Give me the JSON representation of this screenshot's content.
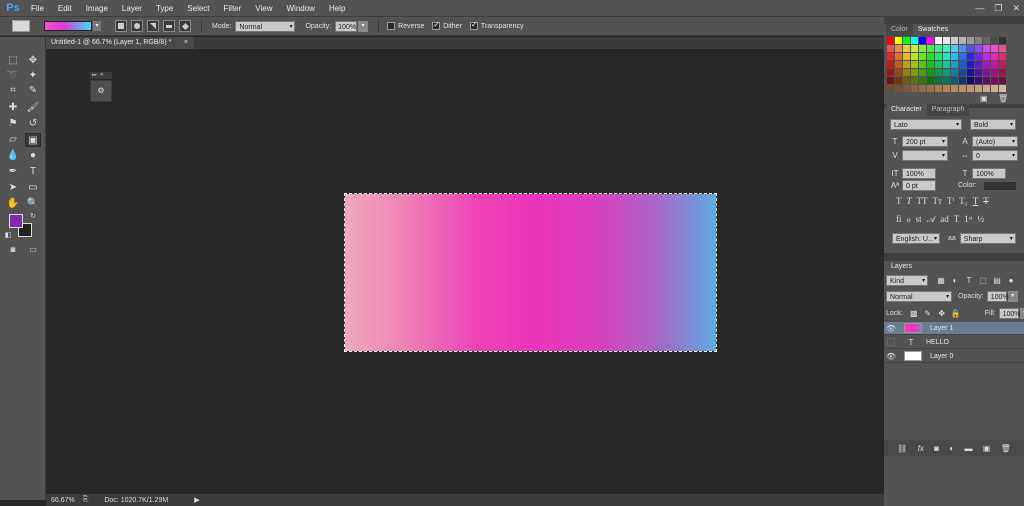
{
  "app": {
    "logo": "Ps"
  },
  "menu": [
    "File",
    "Edit",
    "Image",
    "Layer",
    "Type",
    "Select",
    "Filter",
    "View",
    "Window",
    "Help"
  ],
  "window_controls": {
    "minimize": "—",
    "restore": "❐",
    "close": "✕"
  },
  "options": {
    "mode_label": "Mode:",
    "mode_value": "Normal",
    "opacity_label": "Opacity:",
    "opacity_value": "100%",
    "reverse_label": "Reverse",
    "reverse_checked": false,
    "dither_label": "Dither",
    "dither_checked": true,
    "transparency_label": "Transparency",
    "transparency_checked": true,
    "gradient_colors": [
      "#ff4fc4",
      "#d93cd6",
      "#3cd9ff"
    ]
  },
  "document_tab": {
    "title": "Untitled-1 @ 66.7% (Layer 1, RGB/8) *",
    "close": "×"
  },
  "colors": {
    "foreground": "#7f2bb0",
    "background": "#222222"
  },
  "status": {
    "zoom": "66.67%",
    "doc": "Doc: 1020.7K/1.29M"
  },
  "color_panel": {
    "tabs": [
      "Color",
      "Swatches"
    ],
    "active_tab": "Swatches"
  },
  "character_panel": {
    "tabs": [
      "Character",
      "Paragraph"
    ],
    "font_family": "Lato",
    "font_style": "Bold",
    "font_size": "200 pt",
    "leading": "(Auto)",
    "tracking": "0",
    "vertical_scale": "100%",
    "horizontal_scale": "100%",
    "baseline_shift": "0 pt",
    "color_label": "Color:",
    "language": "English: U...",
    "antialias": "Sharp"
  },
  "layers_panel": {
    "title": "Layers",
    "filter": "Kind",
    "blend_mode": "Normal",
    "opacity_label": "Opacity:",
    "opacity_value": "100%",
    "lock_label": "Lock:",
    "fill_label": "Fill:",
    "fill_value": "100%",
    "layers": [
      {
        "name": "Layer 1",
        "selected": true,
        "visible": true,
        "kind": "gradient"
      },
      {
        "name": "HELLO",
        "selected": false,
        "visible": false,
        "kind": "text"
      },
      {
        "name": "Layer 0",
        "selected": false,
        "visible": true,
        "kind": "white"
      }
    ],
    "bottom_icons": [
      "link-icon",
      "fx-icon",
      "mask-icon",
      "adjustment-icon",
      "group-folder-icon",
      "new-layer-icon",
      "trash-icon"
    ]
  }
}
